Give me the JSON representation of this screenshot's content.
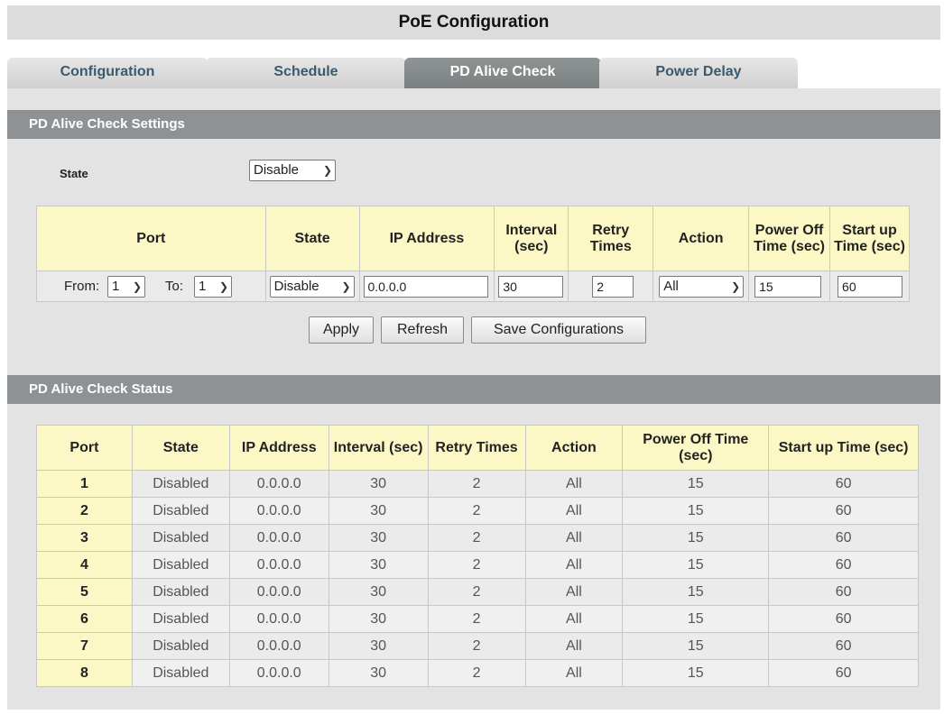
{
  "page_title": "PoE Configuration",
  "tabs": [
    {
      "label": "Configuration",
      "active": false
    },
    {
      "label": "Schedule",
      "active": false
    },
    {
      "label": "PD Alive Check",
      "active": true
    },
    {
      "label": "Power Delay",
      "active": false
    }
  ],
  "settings": {
    "header": "PD Alive Check Settings",
    "state_label": "State",
    "state_value": "Disable",
    "columns": [
      "Port",
      "State",
      "IP Address",
      "Interval (sec)",
      "Retry Times",
      "Action",
      "Power Off Time (sec)",
      "Start up Time (sec)"
    ],
    "from_label": "From:",
    "from_value": "1",
    "to_label": "To:",
    "to_value": "1",
    "row_state": "Disable",
    "ip_address": "0.0.0.0",
    "interval": "30",
    "retry_times": "2",
    "action": "All",
    "power_off_time": "15",
    "startup_time": "60"
  },
  "buttons": {
    "apply": "Apply",
    "refresh": "Refresh",
    "save": "Save Configurations"
  },
  "status": {
    "header": "PD Alive Check Status",
    "columns": [
      "Port",
      "State",
      "IP Address",
      "Interval (sec)",
      "Retry Times",
      "Action",
      "Power Off Time (sec)",
      "Start up Time (sec)"
    ],
    "rows": [
      [
        "1",
        "Disabled",
        "0.0.0.0",
        "30",
        "2",
        "All",
        "15",
        "60"
      ],
      [
        "2",
        "Disabled",
        "0.0.0.0",
        "30",
        "2",
        "All",
        "15",
        "60"
      ],
      [
        "3",
        "Disabled",
        "0.0.0.0",
        "30",
        "2",
        "All",
        "15",
        "60"
      ],
      [
        "4",
        "Disabled",
        "0.0.0.0",
        "30",
        "2",
        "All",
        "15",
        "60"
      ],
      [
        "5",
        "Disabled",
        "0.0.0.0",
        "30",
        "2",
        "All",
        "15",
        "60"
      ],
      [
        "6",
        "Disabled",
        "0.0.0.0",
        "30",
        "2",
        "All",
        "15",
        "60"
      ],
      [
        "7",
        "Disabled",
        "0.0.0.0",
        "30",
        "2",
        "All",
        "15",
        "60"
      ],
      [
        "8",
        "Disabled",
        "0.0.0.0",
        "30",
        "2",
        "All",
        "15",
        "60"
      ]
    ]
  },
  "colors": {
    "header_bg": "#8e9294",
    "table_header_bg": "#fcf8c6",
    "active_tab": "#7a7f80",
    "tab_text": "#3a5a6e"
  }
}
